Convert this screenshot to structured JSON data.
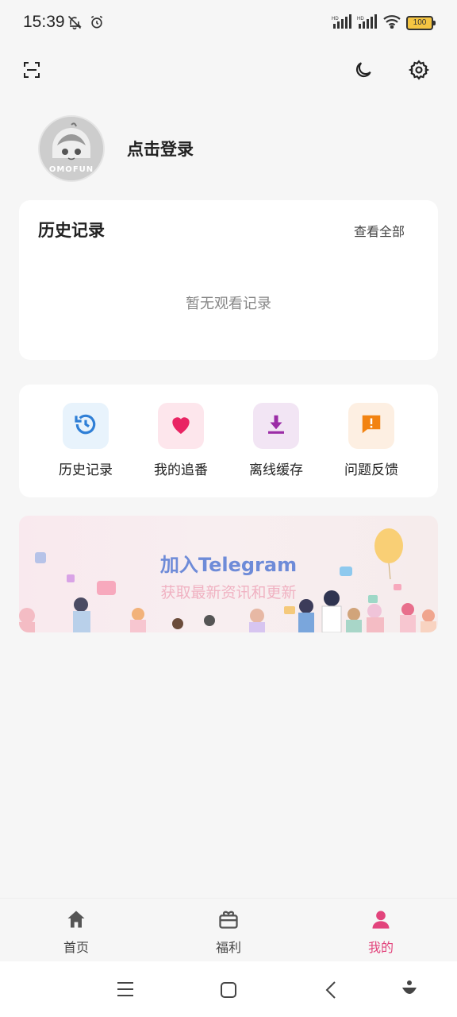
{
  "status_bar": {
    "time": "15:39",
    "battery": "100"
  },
  "profile": {
    "avatar_text": "OMOFUN",
    "login_label": "点击登录"
  },
  "history": {
    "title": "历史记录",
    "view_all": "查看全部",
    "empty_text": "暂无观看记录"
  },
  "quick_actions": [
    {
      "label": "历史记录",
      "icon": "history-icon",
      "bg": "#e8f3fc",
      "color": "#2f7fd6"
    },
    {
      "label": "我的追番",
      "icon": "heart-icon",
      "bg": "#fde6ec",
      "color": "#e92463"
    },
    {
      "label": "离线缓存",
      "icon": "download-icon",
      "bg": "#f2e5f4",
      "color": "#9b2ca6"
    },
    {
      "label": "问题反馈",
      "icon": "feedback-icon",
      "bg": "#fdefe2",
      "color": "#f28311"
    }
  ],
  "banner": {
    "title": "加入Telegram",
    "subtitle": "获取最新资讯和更新"
  },
  "bottom_nav": [
    {
      "label": "首页",
      "icon": "home-icon",
      "active": false
    },
    {
      "label": "福利",
      "icon": "gift-icon",
      "active": false
    },
    {
      "label": "我的",
      "icon": "person-icon",
      "active": true
    }
  ],
  "colors": {
    "accent": "#e2447c",
    "background": "#f6f6f6"
  }
}
